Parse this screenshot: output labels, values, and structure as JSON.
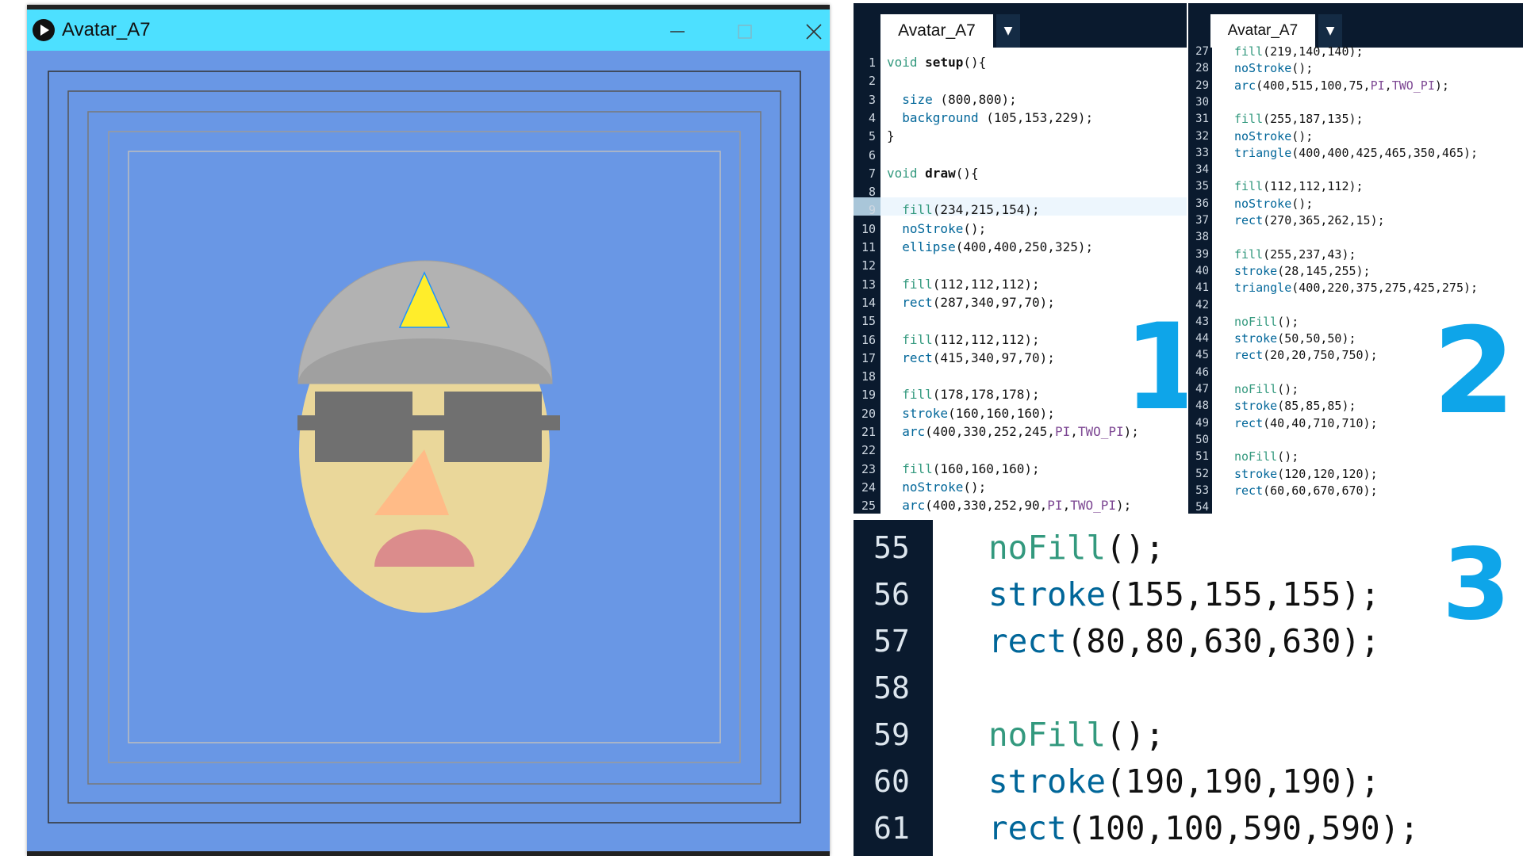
{
  "window": {
    "title": "Avatar_A7",
    "app_icon": "play-circle-icon",
    "controls": [
      "minimize-icon",
      "maximize-icon",
      "close-icon"
    ],
    "title_bar_color": "#4de0ff",
    "background_color": "#6997e5"
  },
  "editor_panels": [
    {
      "tab": "Avatar_A7",
      "label": "1",
      "highlighted_line": "9",
      "lines": [
        {
          "n": "1",
          "code": "void setup(){"
        },
        {
          "n": "2",
          "code": ""
        },
        {
          "n": "3",
          "code": "  size (800,800);"
        },
        {
          "n": "4",
          "code": "  background (105,153,229);"
        },
        {
          "n": "5",
          "code": "}"
        },
        {
          "n": "6",
          "code": ""
        },
        {
          "n": "7",
          "code": "void draw(){"
        },
        {
          "n": "8",
          "code": ""
        },
        {
          "n": "9",
          "code": "  fill(234,215,154);"
        },
        {
          "n": "10",
          "code": "  noStroke();"
        },
        {
          "n": "11",
          "code": "  ellipse(400,400,250,325);"
        },
        {
          "n": "12",
          "code": ""
        },
        {
          "n": "13",
          "code": "  fill(112,112,112);"
        },
        {
          "n": "14",
          "code": "  rect(287,340,97,70);"
        },
        {
          "n": "15",
          "code": ""
        },
        {
          "n": "16",
          "code": "  fill(112,112,112);"
        },
        {
          "n": "17",
          "code": "  rect(415,340,97,70);"
        },
        {
          "n": "18",
          "code": ""
        },
        {
          "n": "19",
          "code": "  fill(178,178,178);"
        },
        {
          "n": "20",
          "code": "  stroke(160,160,160);"
        },
        {
          "n": "21",
          "code": "  arc(400,330,252,245,PI,TWO_PI);"
        },
        {
          "n": "22",
          "code": ""
        },
        {
          "n": "23",
          "code": "  fill(160,160,160);"
        },
        {
          "n": "24",
          "code": "  noStroke();"
        },
        {
          "n": "25",
          "code": "  arc(400,330,252,90,PI,TWO_PI);"
        }
      ]
    },
    {
      "tab": "Avatar_A7",
      "label": "2",
      "lines": [
        {
          "n": "27",
          "code": "fill(219,140,140);"
        },
        {
          "n": "28",
          "code": "noStroke();"
        },
        {
          "n": "29",
          "code": "arc(400,515,100,75,PI,TWO_PI);"
        },
        {
          "n": "30",
          "code": ""
        },
        {
          "n": "31",
          "code": "fill(255,187,135);"
        },
        {
          "n": "32",
          "code": "noStroke();"
        },
        {
          "n": "33",
          "code": "triangle(400,400,425,465,350,465);"
        },
        {
          "n": "34",
          "code": ""
        },
        {
          "n": "35",
          "code": "fill(112,112,112);"
        },
        {
          "n": "36",
          "code": "noStroke();"
        },
        {
          "n": "37",
          "code": "rect(270,365,262,15);"
        },
        {
          "n": "38",
          "code": ""
        },
        {
          "n": "39",
          "code": "fill(255,237,43);"
        },
        {
          "n": "40",
          "code": "stroke(28,145,255);"
        },
        {
          "n": "41",
          "code": "triangle(400,220,375,275,425,275);"
        },
        {
          "n": "42",
          "code": ""
        },
        {
          "n": "43",
          "code": "noFill();"
        },
        {
          "n": "44",
          "code": "stroke(50,50,50);"
        },
        {
          "n": "45",
          "code": "rect(20,20,750,750);"
        },
        {
          "n": "46",
          "code": ""
        },
        {
          "n": "47",
          "code": "noFill();"
        },
        {
          "n": "48",
          "code": "stroke(85,85,85);"
        },
        {
          "n": "49",
          "code": "rect(40,40,710,710);"
        },
        {
          "n": "50",
          "code": ""
        },
        {
          "n": "51",
          "code": "noFill();"
        },
        {
          "n": "52",
          "code": "stroke(120,120,120);"
        },
        {
          "n": "53",
          "code": "rect(60,60,670,670);"
        },
        {
          "n": "54",
          "code": ""
        }
      ]
    },
    {
      "label": "3",
      "lines": [
        {
          "n": "55",
          "code": "noFill();"
        },
        {
          "n": "56",
          "code": "stroke(155,155,155);"
        },
        {
          "n": "57",
          "code": "rect(80,80,630,630);"
        },
        {
          "n": "58",
          "code": ""
        },
        {
          "n": "59",
          "code": "noFill();"
        },
        {
          "n": "60",
          "code": "stroke(190,190,190);"
        },
        {
          "n": "61",
          "code": "rect(100,100,590,590);"
        }
      ]
    }
  ],
  "syntax_colors": {
    "keyword": "#33997e",
    "function": "#006699",
    "constant": "#7d4793",
    "label_accent": "#0ea5e9"
  }
}
